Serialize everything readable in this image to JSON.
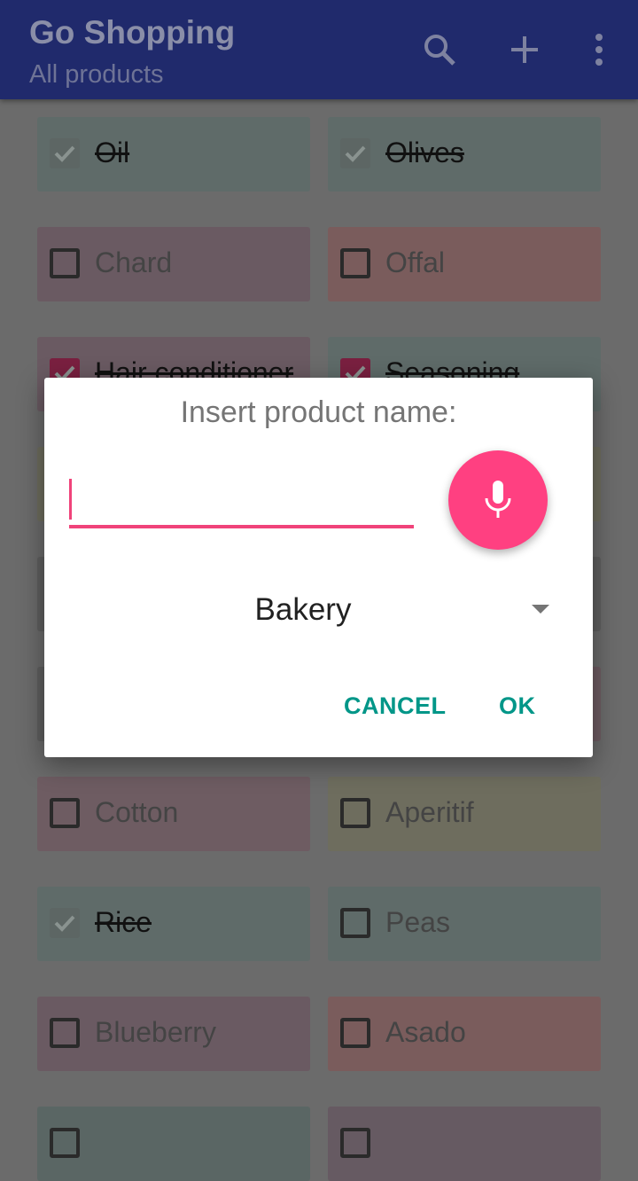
{
  "appbar": {
    "title": "Go Shopping",
    "subtitle": "All products",
    "icons": [
      "search-icon",
      "add-icon",
      "more-vert-icon"
    ],
    "color": "#3f51b5"
  },
  "products": [
    {
      "label": "Oil",
      "checked": true,
      "color": "#5f6b69"
    },
    {
      "label": "Olives",
      "checked": true,
      "color": "#5f6b69"
    },
    {
      "label": "Chard",
      "checked": false,
      "color": "#6a5a62"
    },
    {
      "label": "Offal",
      "checked": false,
      "color": "#7a5c5c"
    },
    {
      "label": "Hair conditioner",
      "checked": true,
      "color": "#6a5a62"
    },
    {
      "label": "Seasoning",
      "checked": true,
      "color": "#5f6b69"
    },
    {
      "label": "",
      "checked": false,
      "color": "#6e6d5e"
    },
    {
      "label": "",
      "checked": false,
      "color": "#6e6d5e"
    },
    {
      "label": "",
      "checked": false,
      "color": "#5f5f5f"
    },
    {
      "label": "",
      "checked": false,
      "color": "#5f5f5f"
    },
    {
      "label": "",
      "checked": false,
      "color": "#5f5f5f"
    },
    {
      "label": "",
      "checked": false,
      "color": "#6e5c62"
    },
    {
      "label": "Cotton",
      "checked": false,
      "color": "#6e5c62"
    },
    {
      "label": "Aperitif",
      "checked": false,
      "color": "#6e6d5e"
    },
    {
      "label": "Rice",
      "checked": true,
      "color": "#5f6b69"
    },
    {
      "label": "Peas",
      "checked": false,
      "color": "#5f6b69"
    },
    {
      "label": "Blueberry",
      "checked": false,
      "color": "#6a5a62"
    },
    {
      "label": "Asado",
      "checked": false,
      "color": "#7a5c5c"
    },
    {
      "label": "",
      "checked": false,
      "color": "#5a6664"
    },
    {
      "label": "",
      "checked": false,
      "color": "#665a62"
    }
  ],
  "dialog": {
    "title": "Insert product name:",
    "input_value": "",
    "accent": "#ff4081",
    "category": "Bakery",
    "cancel": "CANCEL",
    "ok": "OK",
    "button_color": "#009688"
  }
}
